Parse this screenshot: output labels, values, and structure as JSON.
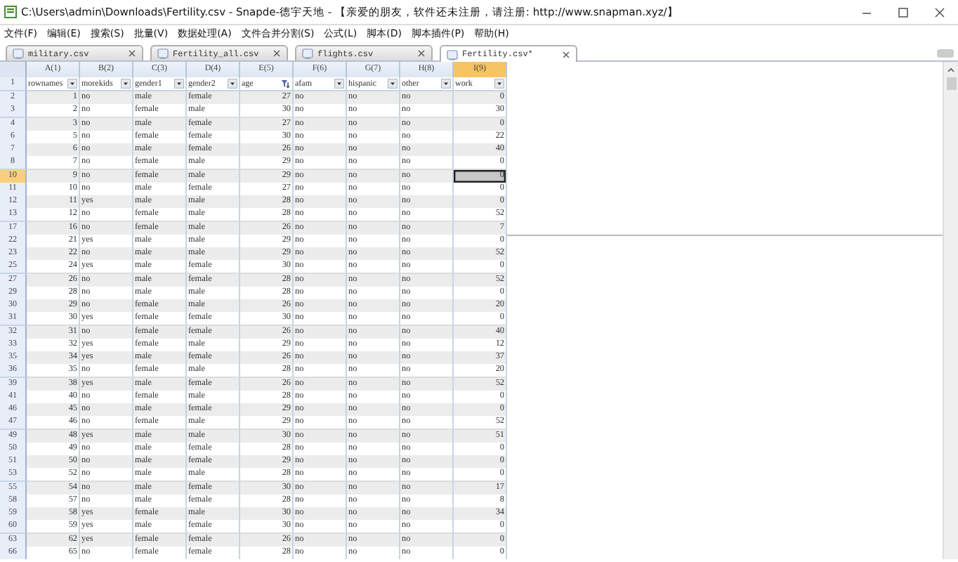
{
  "window": {
    "title": "C:\\Users\\admin\\Downloads\\Fertility.csv - Snapde-德宇天地 - 【亲爱的朋友，软件还未注册，请注册: http://www.snapman.xyz/】"
  },
  "menu": [
    "文件(F)",
    "编辑(E)",
    "搜索(S)",
    "批量(V)",
    "数据处理(A)",
    "文件合并分割(S)",
    "公式(L)",
    "脚本(D)",
    "脚本插件(P)",
    "帮助(H)"
  ],
  "tabs": [
    {
      "label": "military.csv",
      "selected": false
    },
    {
      "label": "Fertility_all.csv",
      "selected": false
    },
    {
      "label": "flights.csv",
      "selected": false
    },
    {
      "label": "Fertility.csv*",
      "selected": true
    }
  ],
  "table": {
    "columns": [
      {
        "label": "A(1)",
        "kind": "number",
        "selected": false
      },
      {
        "label": "B(2)",
        "kind": "text",
        "selected": false
      },
      {
        "label": "C(3)",
        "kind": "text",
        "selected": false
      },
      {
        "label": "D(4)",
        "kind": "text",
        "selected": false
      },
      {
        "label": "E(5)",
        "kind": "number",
        "selected": false
      },
      {
        "label": "F(6)",
        "kind": "text",
        "selected": false
      },
      {
        "label": "G(7)",
        "kind": "text",
        "selected": false
      },
      {
        "label": "H(8)",
        "kind": "text",
        "selected": false
      },
      {
        "label": "I(9)",
        "kind": "number",
        "selected": true
      }
    ],
    "filter_row": {
      "row": "1",
      "fields": [
        {
          "label": "rownames",
          "kind": "dropdown"
        },
        {
          "label": "morekids",
          "kind": "dropdown"
        },
        {
          "label": "gender1",
          "kind": "dropdown"
        },
        {
          "label": "gender2",
          "kind": "dropdown"
        },
        {
          "label": "age",
          "kind": "filter"
        },
        {
          "label": "afam",
          "kind": "dropdown"
        },
        {
          "label": "hispanic",
          "kind": "dropdown"
        },
        {
          "label": "other",
          "kind": "dropdown"
        },
        {
          "label": "work",
          "kind": "dropdown"
        }
      ]
    },
    "rows": [
      {
        "row": "2",
        "selected": false,
        "cells": [
          "1",
          "no",
          "male",
          "female",
          "27",
          "no",
          "no",
          "no",
          "0"
        ]
      },
      {
        "row": "3",
        "selected": false,
        "cells": [
          "2",
          "no",
          "female",
          "male",
          "30",
          "no",
          "no",
          "no",
          "30"
        ]
      },
      {
        "row": "4",
        "selected": false,
        "cells": [
          "3",
          "no",
          "male",
          "female",
          "27",
          "no",
          "no",
          "no",
          "0"
        ]
      },
      {
        "row": "6",
        "selected": false,
        "cells": [
          "5",
          "no",
          "female",
          "female",
          "30",
          "no",
          "no",
          "no",
          "22"
        ]
      },
      {
        "row": "7",
        "selected": false,
        "cells": [
          "6",
          "no",
          "male",
          "female",
          "26",
          "no",
          "no",
          "no",
          "40"
        ]
      },
      {
        "row": "8",
        "selected": false,
        "cells": [
          "7",
          "no",
          "female",
          "male",
          "29",
          "no",
          "no",
          "no",
          "0"
        ]
      },
      {
        "row": "10",
        "selected": true,
        "cells": [
          "9",
          "no",
          "female",
          "male",
          "29",
          "no",
          "no",
          "no",
          "0"
        ]
      },
      {
        "row": "11",
        "selected": false,
        "cells": [
          "10",
          "no",
          "male",
          "female",
          "27",
          "no",
          "no",
          "no",
          "0"
        ]
      },
      {
        "row": "12",
        "selected": false,
        "cells": [
          "11",
          "yes",
          "male",
          "male",
          "28",
          "no",
          "no",
          "no",
          "0"
        ]
      },
      {
        "row": "13",
        "selected": false,
        "cells": [
          "12",
          "no",
          "female",
          "male",
          "28",
          "no",
          "no",
          "no",
          "52"
        ]
      },
      {
        "row": "17",
        "selected": false,
        "cells": [
          "16",
          "no",
          "female",
          "male",
          "26",
          "no",
          "no",
          "no",
          "7"
        ]
      },
      {
        "row": "22",
        "selected": false,
        "cells": [
          "21",
          "yes",
          "male",
          "male",
          "29",
          "no",
          "no",
          "no",
          "0"
        ]
      },
      {
        "row": "23",
        "selected": false,
        "cells": [
          "22",
          "no",
          "male",
          "male",
          "29",
          "no",
          "no",
          "no",
          "52"
        ]
      },
      {
        "row": "25",
        "selected": false,
        "cells": [
          "24",
          "yes",
          "male",
          "female",
          "30",
          "no",
          "no",
          "no",
          "0"
        ]
      },
      {
        "row": "27",
        "selected": false,
        "cells": [
          "26",
          "no",
          "male",
          "female",
          "28",
          "no",
          "no",
          "no",
          "52"
        ]
      },
      {
        "row": "29",
        "selected": false,
        "cells": [
          "28",
          "no",
          "male",
          "male",
          "28",
          "no",
          "no",
          "no",
          "0"
        ]
      },
      {
        "row": "30",
        "selected": false,
        "cells": [
          "29",
          "no",
          "female",
          "male",
          "26",
          "no",
          "no",
          "no",
          "20"
        ]
      },
      {
        "row": "31",
        "selected": false,
        "cells": [
          "30",
          "yes",
          "female",
          "female",
          "30",
          "no",
          "no",
          "no",
          "0"
        ]
      },
      {
        "row": "32",
        "selected": false,
        "cells": [
          "31",
          "no",
          "female",
          "female",
          "26",
          "no",
          "no",
          "no",
          "40"
        ]
      },
      {
        "row": "33",
        "selected": false,
        "cells": [
          "32",
          "yes",
          "female",
          "male",
          "29",
          "no",
          "no",
          "no",
          "12"
        ]
      },
      {
        "row": "35",
        "selected": false,
        "cells": [
          "34",
          "yes",
          "male",
          "female",
          "26",
          "no",
          "no",
          "no",
          "37"
        ]
      },
      {
        "row": "36",
        "selected": false,
        "cells": [
          "35",
          "no",
          "female",
          "male",
          "28",
          "no",
          "no",
          "no",
          "20"
        ]
      },
      {
        "row": "39",
        "selected": false,
        "cells": [
          "38",
          "yes",
          "male",
          "female",
          "26",
          "no",
          "no",
          "no",
          "52"
        ]
      },
      {
        "row": "41",
        "selected": false,
        "cells": [
          "40",
          "no",
          "female",
          "male",
          "28",
          "no",
          "no",
          "no",
          "0"
        ]
      },
      {
        "row": "46",
        "selected": false,
        "cells": [
          "45",
          "no",
          "male",
          "female",
          "29",
          "no",
          "no",
          "no",
          "0"
        ]
      },
      {
        "row": "47",
        "selected": false,
        "cells": [
          "46",
          "no",
          "female",
          "male",
          "29",
          "no",
          "no",
          "no",
          "52"
        ]
      },
      {
        "row": "49",
        "selected": false,
        "cells": [
          "48",
          "yes",
          "male",
          "male",
          "30",
          "no",
          "no",
          "no",
          "51"
        ]
      },
      {
        "row": "50",
        "selected": false,
        "cells": [
          "49",
          "no",
          "male",
          "female",
          "28",
          "no",
          "no",
          "no",
          "0"
        ]
      },
      {
        "row": "51",
        "selected": false,
        "cells": [
          "50",
          "no",
          "male",
          "female",
          "29",
          "no",
          "no",
          "no",
          "0"
        ]
      },
      {
        "row": "53",
        "selected": false,
        "cells": [
          "52",
          "no",
          "male",
          "male",
          "28",
          "no",
          "no",
          "no",
          "0"
        ]
      },
      {
        "row": "55",
        "selected": false,
        "cells": [
          "54",
          "no",
          "male",
          "female",
          "30",
          "no",
          "no",
          "no",
          "17"
        ]
      },
      {
        "row": "58",
        "selected": false,
        "cells": [
          "57",
          "no",
          "male",
          "female",
          "28",
          "no",
          "no",
          "no",
          "8"
        ]
      },
      {
        "row": "59",
        "selected": false,
        "cells": [
          "58",
          "yes",
          "female",
          "male",
          "30",
          "no",
          "no",
          "no",
          "34"
        ]
      },
      {
        "row": "60",
        "selected": false,
        "cells": [
          "59",
          "yes",
          "male",
          "female",
          "30",
          "no",
          "no",
          "no",
          "0"
        ]
      },
      {
        "row": "63",
        "selected": false,
        "cells": [
          "62",
          "yes",
          "female",
          "female",
          "26",
          "no",
          "no",
          "no",
          "0"
        ]
      },
      {
        "row": "66",
        "selected": false,
        "cells": [
          "65",
          "no",
          "female",
          "female",
          "28",
          "no",
          "no",
          "no",
          "0"
        ]
      }
    ]
  }
}
